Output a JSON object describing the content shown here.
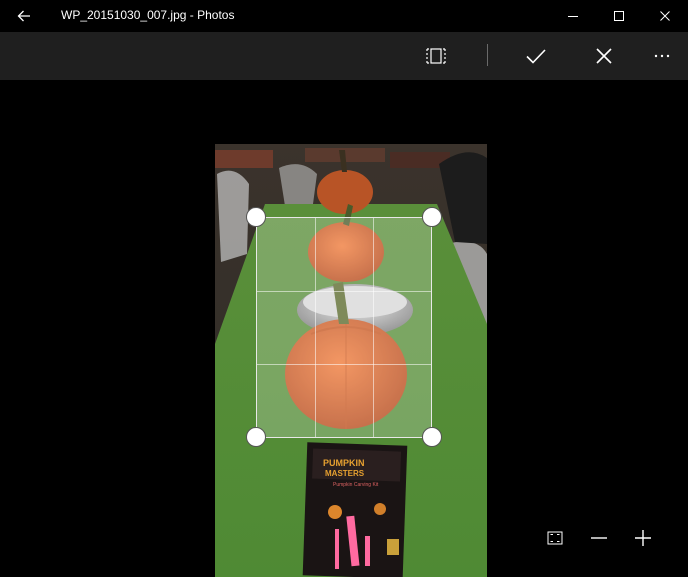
{
  "titlebar": {
    "title": "WP_20151030_007.jpg - Photos",
    "back_icon": "back-arrow-icon",
    "minimize_icon": "minimize-icon",
    "maximize_icon": "maximize-icon",
    "close_icon": "close-icon"
  },
  "toolbar": {
    "aspect_ratio_icon": "aspect-ratio-icon",
    "done_icon": "checkmark-icon",
    "cancel_icon": "cancel-x-icon",
    "more_icon": "more-ellipsis-icon"
  },
  "crop": {
    "photo_description_hidden": "",
    "box_art_lines": [
      "PUMPKIN",
      "MASTERS",
      "Pumpkin Carving Kit"
    ]
  },
  "zoom_controls": {
    "fit_icon": "fit-to-window-icon",
    "zoom_out_icon": "zoom-out-minus-icon",
    "zoom_in_icon": "zoom-in-plus-icon"
  },
  "colors": {
    "titlebar_bg": "#000000",
    "toolbar_bg": "#1f1f1f",
    "stage_bg": "#000000",
    "tablecloth": "#5f9e3f",
    "pumpkin": "#e0622a"
  }
}
